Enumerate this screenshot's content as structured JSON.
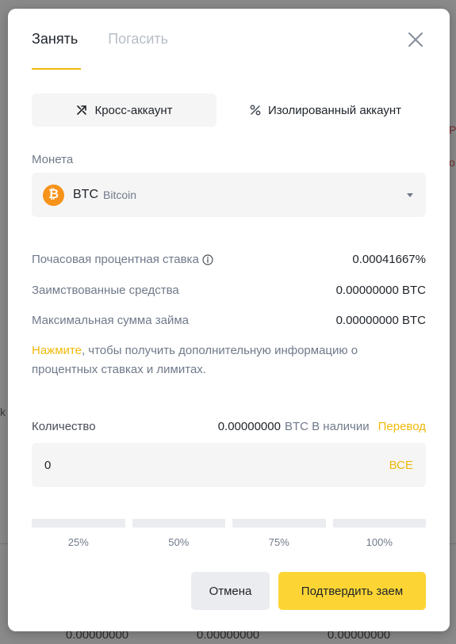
{
  "background": {
    "side_right_1": "P",
    "side_right_2": "o",
    "side_left": "k",
    "footer_values": [
      "0.00000000",
      "0.00000000",
      "0.00000000"
    ]
  },
  "modal": {
    "tabs": [
      {
        "label": "Занять",
        "active": true
      },
      {
        "label": "Погасить",
        "active": false
      }
    ],
    "account": {
      "cross_label": "Кросс-аккаунт",
      "isolated_label": "Изолированный аккаунт"
    },
    "coin": {
      "label": "Монета",
      "symbol": "BTC",
      "name": "Bitcoin",
      "icon_glyph": "₿",
      "icon_color": "#f7931a"
    },
    "info": {
      "hourly_rate_label": "Почасовая процентная ставка",
      "hourly_rate_value": "0.00041667%",
      "borrowed_label": "Заимствованные средства",
      "borrowed_value": "0.00000000 BTC",
      "max_loan_label": "Максимальная сумма займа",
      "max_loan_value": "0.00000000 BTC"
    },
    "note": {
      "link": "Нажмите",
      "text": ", чтобы получить дополнительную информацию о процентных ставках и лимитах."
    },
    "quantity": {
      "label": "Количество",
      "available_amount": "0.00000000",
      "available_unit": "BTC В наличии",
      "transfer_label": "Перевод",
      "value": "0",
      "max_label": "ВСЕ"
    },
    "percent_options": [
      "25%",
      "50%",
      "75%",
      "100%"
    ],
    "actions": {
      "cancel": "Отмена",
      "confirm": "Подтвердить заем"
    }
  },
  "colors": {
    "accent": "#f0b90b",
    "primary_button": "#fcd535",
    "text_primary": "#1e2329",
    "text_secondary": "#707a8a"
  }
}
